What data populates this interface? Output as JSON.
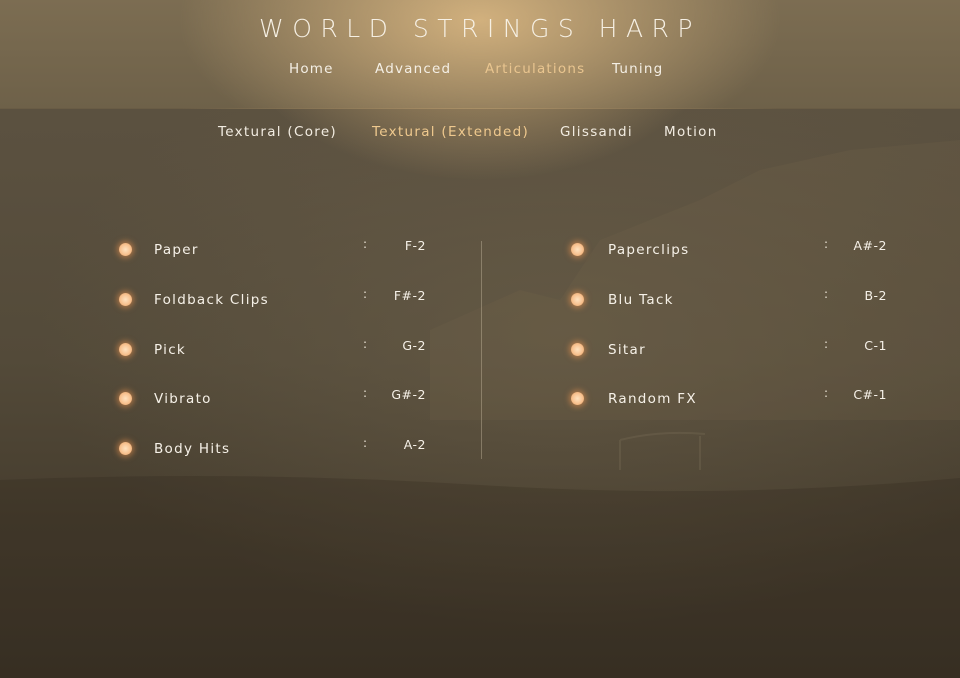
{
  "app": {
    "title": "WORLD STRINGS HARP"
  },
  "nav": {
    "items": [
      "Home",
      "Advanced",
      "Articulations",
      "Tuning"
    ],
    "active": "Articulations"
  },
  "subtabs": {
    "items": [
      "Textural (Core)",
      "Textural (Extended)",
      "Glissandi",
      "Motion"
    ],
    "active": "Textural (Extended)"
  },
  "articulations": {
    "separator": ":",
    "left": [
      {
        "name": "Paper",
        "key": "F-2"
      },
      {
        "name": "Foldback Clips",
        "key": "F#-2"
      },
      {
        "name": "Pick",
        "key": "G-2"
      },
      {
        "name": "Vibrato",
        "key": "G#-2"
      },
      {
        "name": "Body Hits",
        "key": "A-2"
      }
    ],
    "right": [
      {
        "name": "Paperclips",
        "key": "A#-2"
      },
      {
        "name": "Blu Tack",
        "key": "B-2"
      },
      {
        "name": "Sitar",
        "key": "C-1"
      },
      {
        "name": "Random FX",
        "key": "C#-1"
      }
    ]
  },
  "colors": {
    "accent": "#e9c58f",
    "indicator": "#f8c290",
    "text": "#f6f1e8"
  },
  "icons": {
    "indicator": "articulation-indicator-dot"
  }
}
